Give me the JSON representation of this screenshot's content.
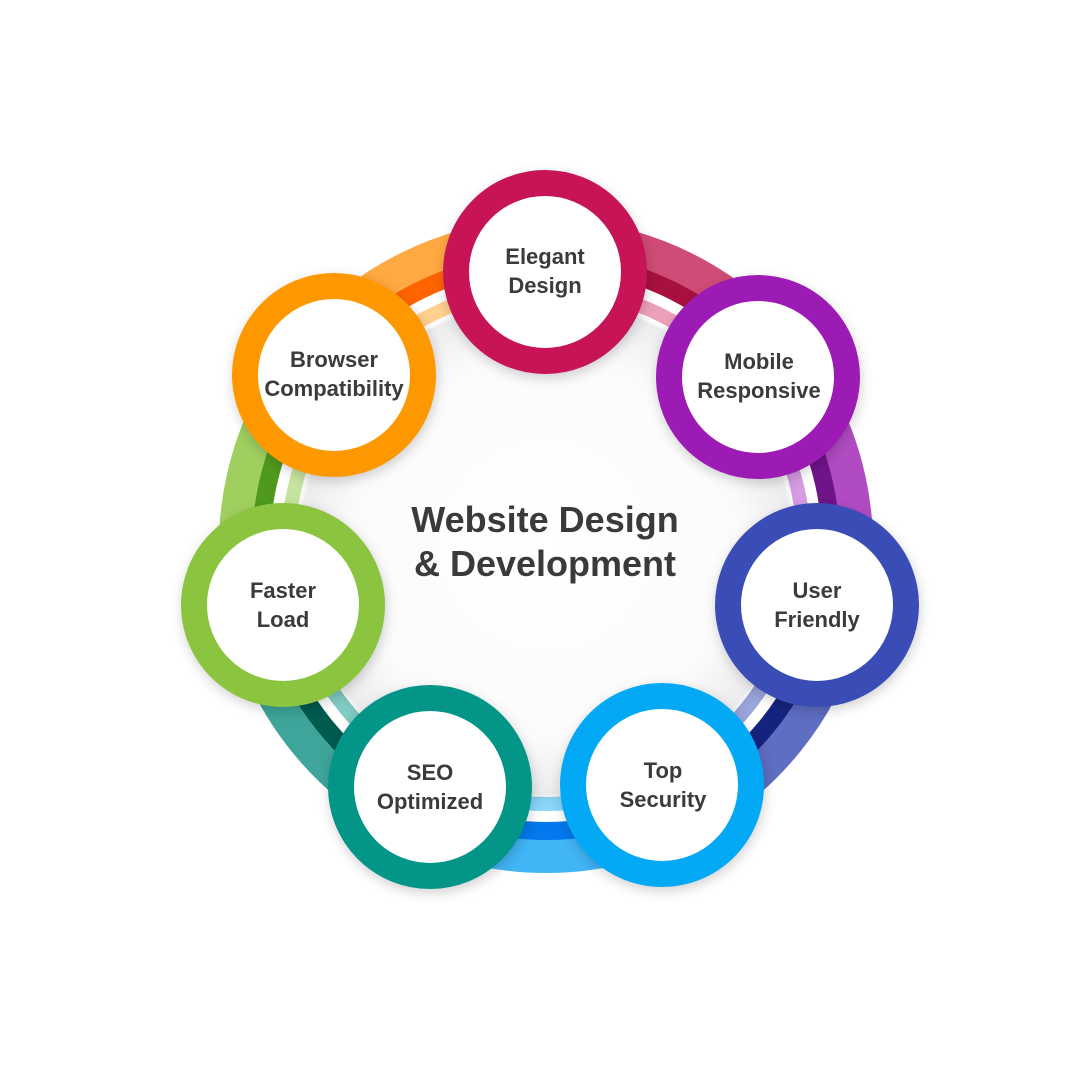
{
  "center": {
    "line1": "Website Design",
    "line2": "& Development"
  },
  "nodes": [
    {
      "line1": "Elegant",
      "line2": "Design",
      "color": "#C71457"
    },
    {
      "line1": "Mobile",
      "line2": "Responsive",
      "color": "#9C1BB4"
    },
    {
      "line1": "User",
      "line2": "Friendly",
      "color": "#3A4CB6"
    },
    {
      "line1": "Top",
      "line2": "Security",
      "color": "#03A9F5"
    },
    {
      "line1": "SEO",
      "line2": "Optimized",
      "color": "#039587"
    },
    {
      "line1": "Faster",
      "line2": "Load",
      "color": "#8BC43F"
    },
    {
      "line1": "Browser",
      "line2": "Compatibility",
      "color": "#FE9801"
    }
  ],
  "ring_palettes": [
    {
      "outer": "#CF4C77",
      "dark": "#A8103F",
      "light": "#EDA0BC"
    },
    {
      "outer": "#B14BC2",
      "dark": "#6F1489",
      "light": "#D79BE3"
    },
    {
      "outer": "#5F6DC2",
      "dark": "#16237E",
      "light": "#9AA5DC"
    },
    {
      "outer": "#42B5F7",
      "dark": "#0279ED",
      "light": "#8CD7FB"
    },
    {
      "outer": "#3FA59A",
      "dark": "#005A4E",
      "light": "#80CBC3"
    },
    {
      "outer": "#A0CF60",
      "dark": "#4F9A1D",
      "light": "#C6E4A1"
    },
    {
      "outer": "#FEA942",
      "dark": "#FF6400",
      "light": "#FFD08F"
    }
  ]
}
